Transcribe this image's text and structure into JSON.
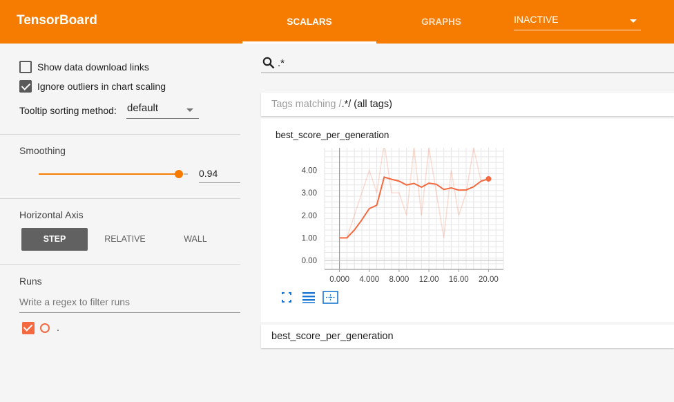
{
  "app": {
    "title": "TensorBoard"
  },
  "header": {
    "tabs": [
      {
        "label": "SCALARS",
        "active": true
      },
      {
        "label": "GRAPHS",
        "active": false
      }
    ],
    "run_selector": {
      "value": "INACTIVE"
    }
  },
  "sidebar": {
    "show_download_links": {
      "label": "Show data download links",
      "checked": false
    },
    "ignore_outliers": {
      "label": "Ignore outliers in chart scaling",
      "checked": true
    },
    "tooltip_sort": {
      "label": "Tooltip sorting method:",
      "value": "default"
    },
    "smoothing": {
      "title": "Smoothing",
      "value": "0.94",
      "fraction": 0.94
    },
    "horizontal_axis": {
      "title": "Horizontal Axis",
      "options": [
        "STEP",
        "RELATIVE",
        "WALL"
      ],
      "selected": "STEP"
    },
    "runs": {
      "title": "Runs",
      "filter_placeholder": "Write a regex to filter runs",
      "items": [
        {
          "name": ".",
          "checked": true,
          "color": "#f4693f"
        }
      ]
    }
  },
  "main": {
    "search": {
      "query": ".*"
    },
    "tags_header": {
      "prefix": "Tags matching /",
      "pattern": ".*",
      "suffix": "/ (all tags)"
    },
    "bottom_card": {
      "title": "best_score_per_generation"
    }
  },
  "colors": {
    "accent": "#f57c00",
    "series": "#f4693f"
  },
  "chart_data": {
    "type": "line",
    "title": "best_score_per_generation",
    "x_tick_labels": [
      "0.000",
      "4.000",
      "8.000",
      "12.00",
      "16.00",
      "20.00"
    ],
    "y_tick_labels": [
      "0.00",
      "1.00",
      "2.00",
      "3.00",
      "4.00"
    ],
    "xlim": [
      -2,
      22
    ],
    "ylim": [
      -0.4,
      5.0
    ],
    "grid": true,
    "series": [
      {
        "smoothed": true,
        "x": [
          0,
          1,
          2,
          3,
          4,
          5,
          6,
          7,
          8,
          9,
          10,
          11,
          12,
          13,
          14,
          15,
          16,
          17,
          18,
          19,
          20
        ],
        "y": [
          1.0,
          1.0,
          1.35,
          1.8,
          2.3,
          2.45,
          3.7,
          3.6,
          3.52,
          3.35,
          3.42,
          3.25,
          3.43,
          3.38,
          3.15,
          3.22,
          3.12,
          3.13,
          3.27,
          3.52,
          3.62
        ]
      },
      {
        "raw": true,
        "x": [
          0,
          1,
          2,
          3,
          4,
          5,
          6,
          7,
          8,
          9,
          10,
          11,
          12,
          13,
          14,
          15,
          16,
          17,
          18,
          19
        ],
        "y": [
          1.0,
          1.0,
          2.0,
          3.0,
          4.0,
          3.0,
          5.2,
          3.0,
          3.0,
          2.0,
          5.0,
          2.0,
          5.0,
          3.0,
          1.0,
          4.0,
          2.0,
          3.0,
          5.0,
          3.5
        ]
      }
    ]
  }
}
